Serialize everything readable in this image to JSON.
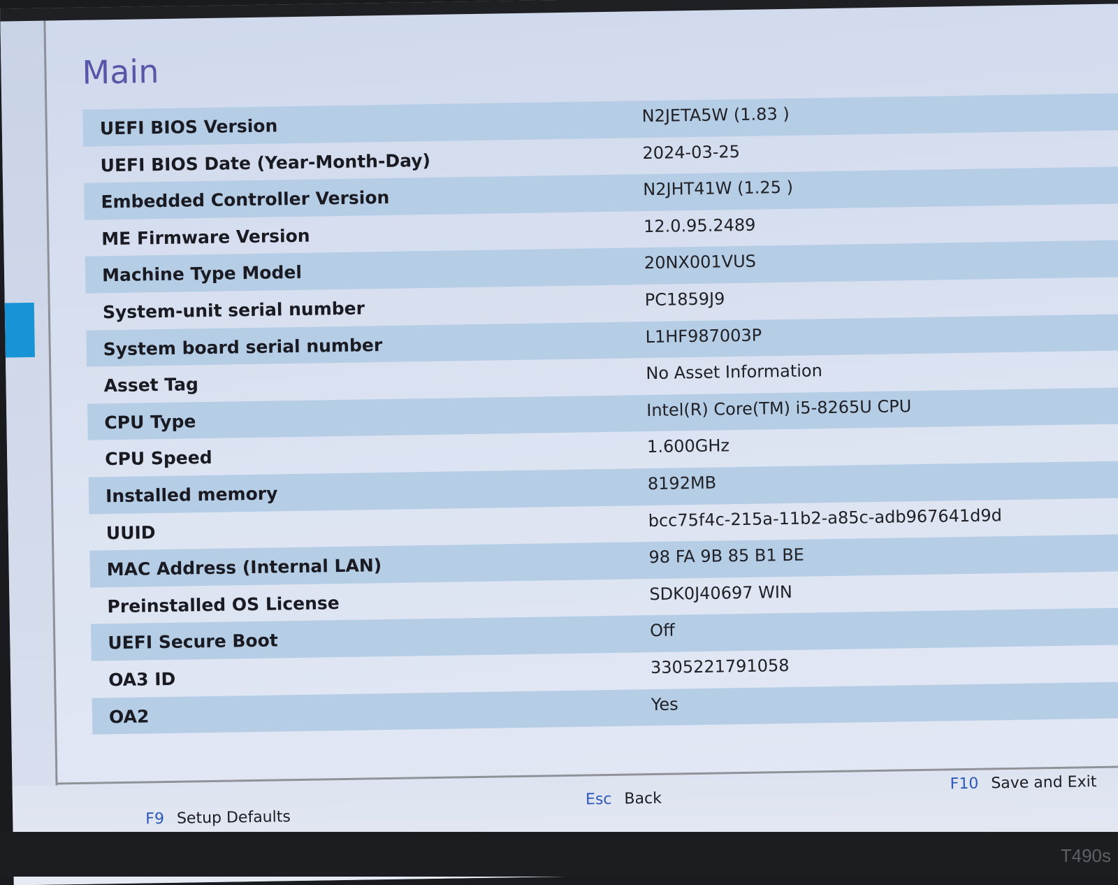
{
  "page": {
    "title": "Main"
  },
  "info_rows": [
    {
      "label": "UEFI BIOS Version",
      "value": "N2JETA5W (1.83 )"
    },
    {
      "label": "UEFI BIOS Date (Year-Month-Day)",
      "value": "2024-03-25"
    },
    {
      "label": "Embedded Controller Version",
      "value": "N2JHT41W (1.25 )"
    },
    {
      "label": "ME Firmware Version",
      "value": "12.0.95.2489"
    },
    {
      "label": "Machine Type Model",
      "value": "20NX001VUS"
    },
    {
      "label": "System-unit serial number",
      "value": "PC1859J9"
    },
    {
      "label": "System board serial number",
      "value": "L1HF987003P"
    },
    {
      "label": "Asset Tag",
      "value": "No Asset Information"
    },
    {
      "label": "CPU Type",
      "value": "Intel(R) Core(TM) i5-8265U CPU"
    },
    {
      "label": "CPU Speed",
      "value": "1.600GHz"
    },
    {
      "label": "Installed memory",
      "value": "8192MB"
    },
    {
      "label": "UUID",
      "value": "bcc75f4c-215a-11b2-a85c-adb967641d9d"
    },
    {
      "label": "MAC Address (Internal LAN)",
      "value": "98 FA 9B 85 B1 BE"
    },
    {
      "label": "Preinstalled OS License",
      "value": "SDK0J40697 WIN"
    },
    {
      "label": "UEFI Secure Boot",
      "value": "Off"
    },
    {
      "label": "OA3 ID",
      "value": "3305221791058"
    },
    {
      "label": "OA2",
      "value": "Yes"
    }
  ],
  "footer": {
    "setup_defaults": {
      "key": "F9",
      "label": "Setup Defaults"
    },
    "back": {
      "key": "Esc",
      "label": "Back"
    },
    "save_exit": {
      "key": "F10",
      "label": "Save and Exit"
    }
  },
  "device": {
    "model": "T490s"
  },
  "colors": {
    "accent_title": "#5a55a7",
    "row_shade": "#b6cde6",
    "sidebar_selected": "#1793d6",
    "footer_key": "#2e58b8"
  }
}
